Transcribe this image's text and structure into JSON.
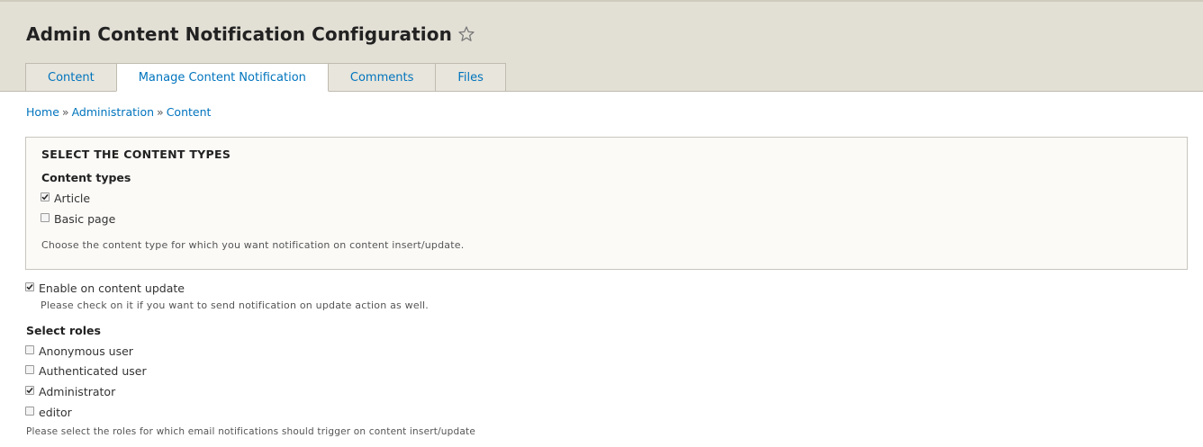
{
  "header": {
    "title": "Admin Content Notification Configuration",
    "tabs": [
      {
        "label": "Content",
        "active": false
      },
      {
        "label": "Manage Content Notification",
        "active": true
      },
      {
        "label": "Comments",
        "active": false
      },
      {
        "label": "Files",
        "active": false
      }
    ]
  },
  "breadcrumb": {
    "items": [
      "Home",
      "Administration",
      "Content"
    ],
    "separator": "»"
  },
  "content_types": {
    "legend": "SELECT THE CONTENT TYPES",
    "label": "Content types",
    "options": [
      {
        "label": "Article",
        "checked": true
      },
      {
        "label": "Basic page",
        "checked": false
      }
    ],
    "description": "Choose the content type for which you want notification on content insert/update."
  },
  "enable_update": {
    "label": "Enable on content update",
    "checked": true,
    "description": "Please check on it if you want to send notification on update action as well."
  },
  "roles": {
    "label": "Select roles",
    "options": [
      {
        "label": "Anonymous user",
        "checked": false
      },
      {
        "label": "Authenticated user",
        "checked": false
      },
      {
        "label": "Administrator",
        "checked": true
      },
      {
        "label": "editor",
        "checked": false
      }
    ],
    "description": "Please select the roles for which email notifications should trigger on content insert/update"
  },
  "colors": {
    "header_bg": "#e2dfd5",
    "link": "#0074bd",
    "fieldset_bg": "#fbfaf7"
  },
  "icons": {
    "star": "star-outline-icon",
    "check": "checkmark-icon"
  }
}
